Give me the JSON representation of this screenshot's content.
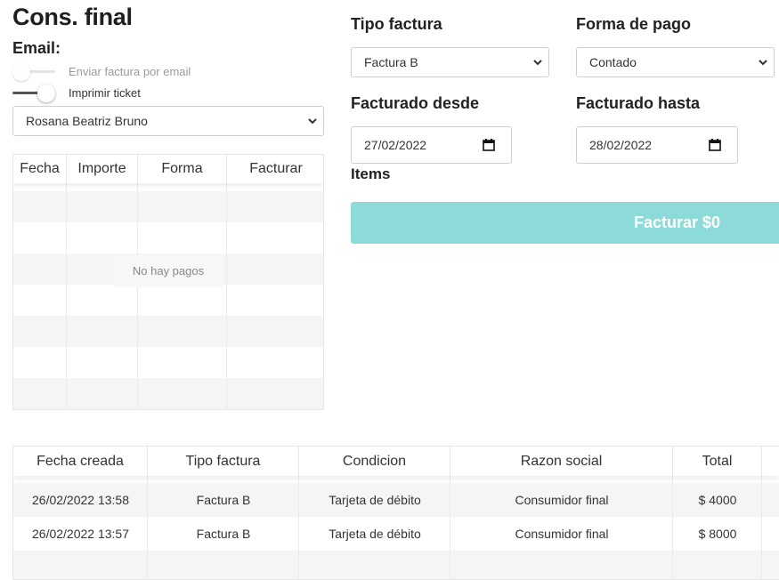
{
  "page": {
    "title": "Cons. final",
    "email_label": "Email:"
  },
  "toggles": {
    "send_email": {
      "label": "Enviar factura por email",
      "on": false
    },
    "print_ticket": {
      "label": "Imprimir ticket",
      "on": true
    }
  },
  "client_select": {
    "value": "Rosana Beatriz Bruno"
  },
  "payments_table": {
    "columns": [
      "Fecha",
      "Importe",
      "Forma",
      "Facturar"
    ],
    "empty_text": "No hay pagos"
  },
  "filters": {
    "tipo_factura": {
      "label": "Tipo factura",
      "value": "Factura B"
    },
    "forma_pago": {
      "label": "Forma de pago",
      "value": "Contado"
    },
    "desde": {
      "label": "Facturado desde",
      "value": "27/02/2022"
    },
    "hasta": {
      "label": "Facturado hasta",
      "value": "28/02/2022"
    }
  },
  "items_label": "Items",
  "facturar_button": "Facturar $0",
  "invoices_table": {
    "columns": [
      "Fecha creada",
      "Tipo factura",
      "Condicion",
      "Razon social",
      "Total"
    ],
    "rows": [
      {
        "fecha": "26/02/2022 13:58",
        "tipo": "Factura B",
        "condicion": "Tarjeta de débito",
        "razon": "Consumidor final",
        "total": "$ 4000"
      },
      {
        "fecha": "26/02/2022 13:57",
        "tipo": "Factura B",
        "condicion": "Tarjeta de débito",
        "razon": "Consumidor final",
        "total": "$ 8000"
      }
    ]
  },
  "colors": {
    "accent": "#8ddbd9"
  },
  "icons": {
    "select_arrow": "chevron-down-icon",
    "date_picker": "calendar-icon"
  }
}
